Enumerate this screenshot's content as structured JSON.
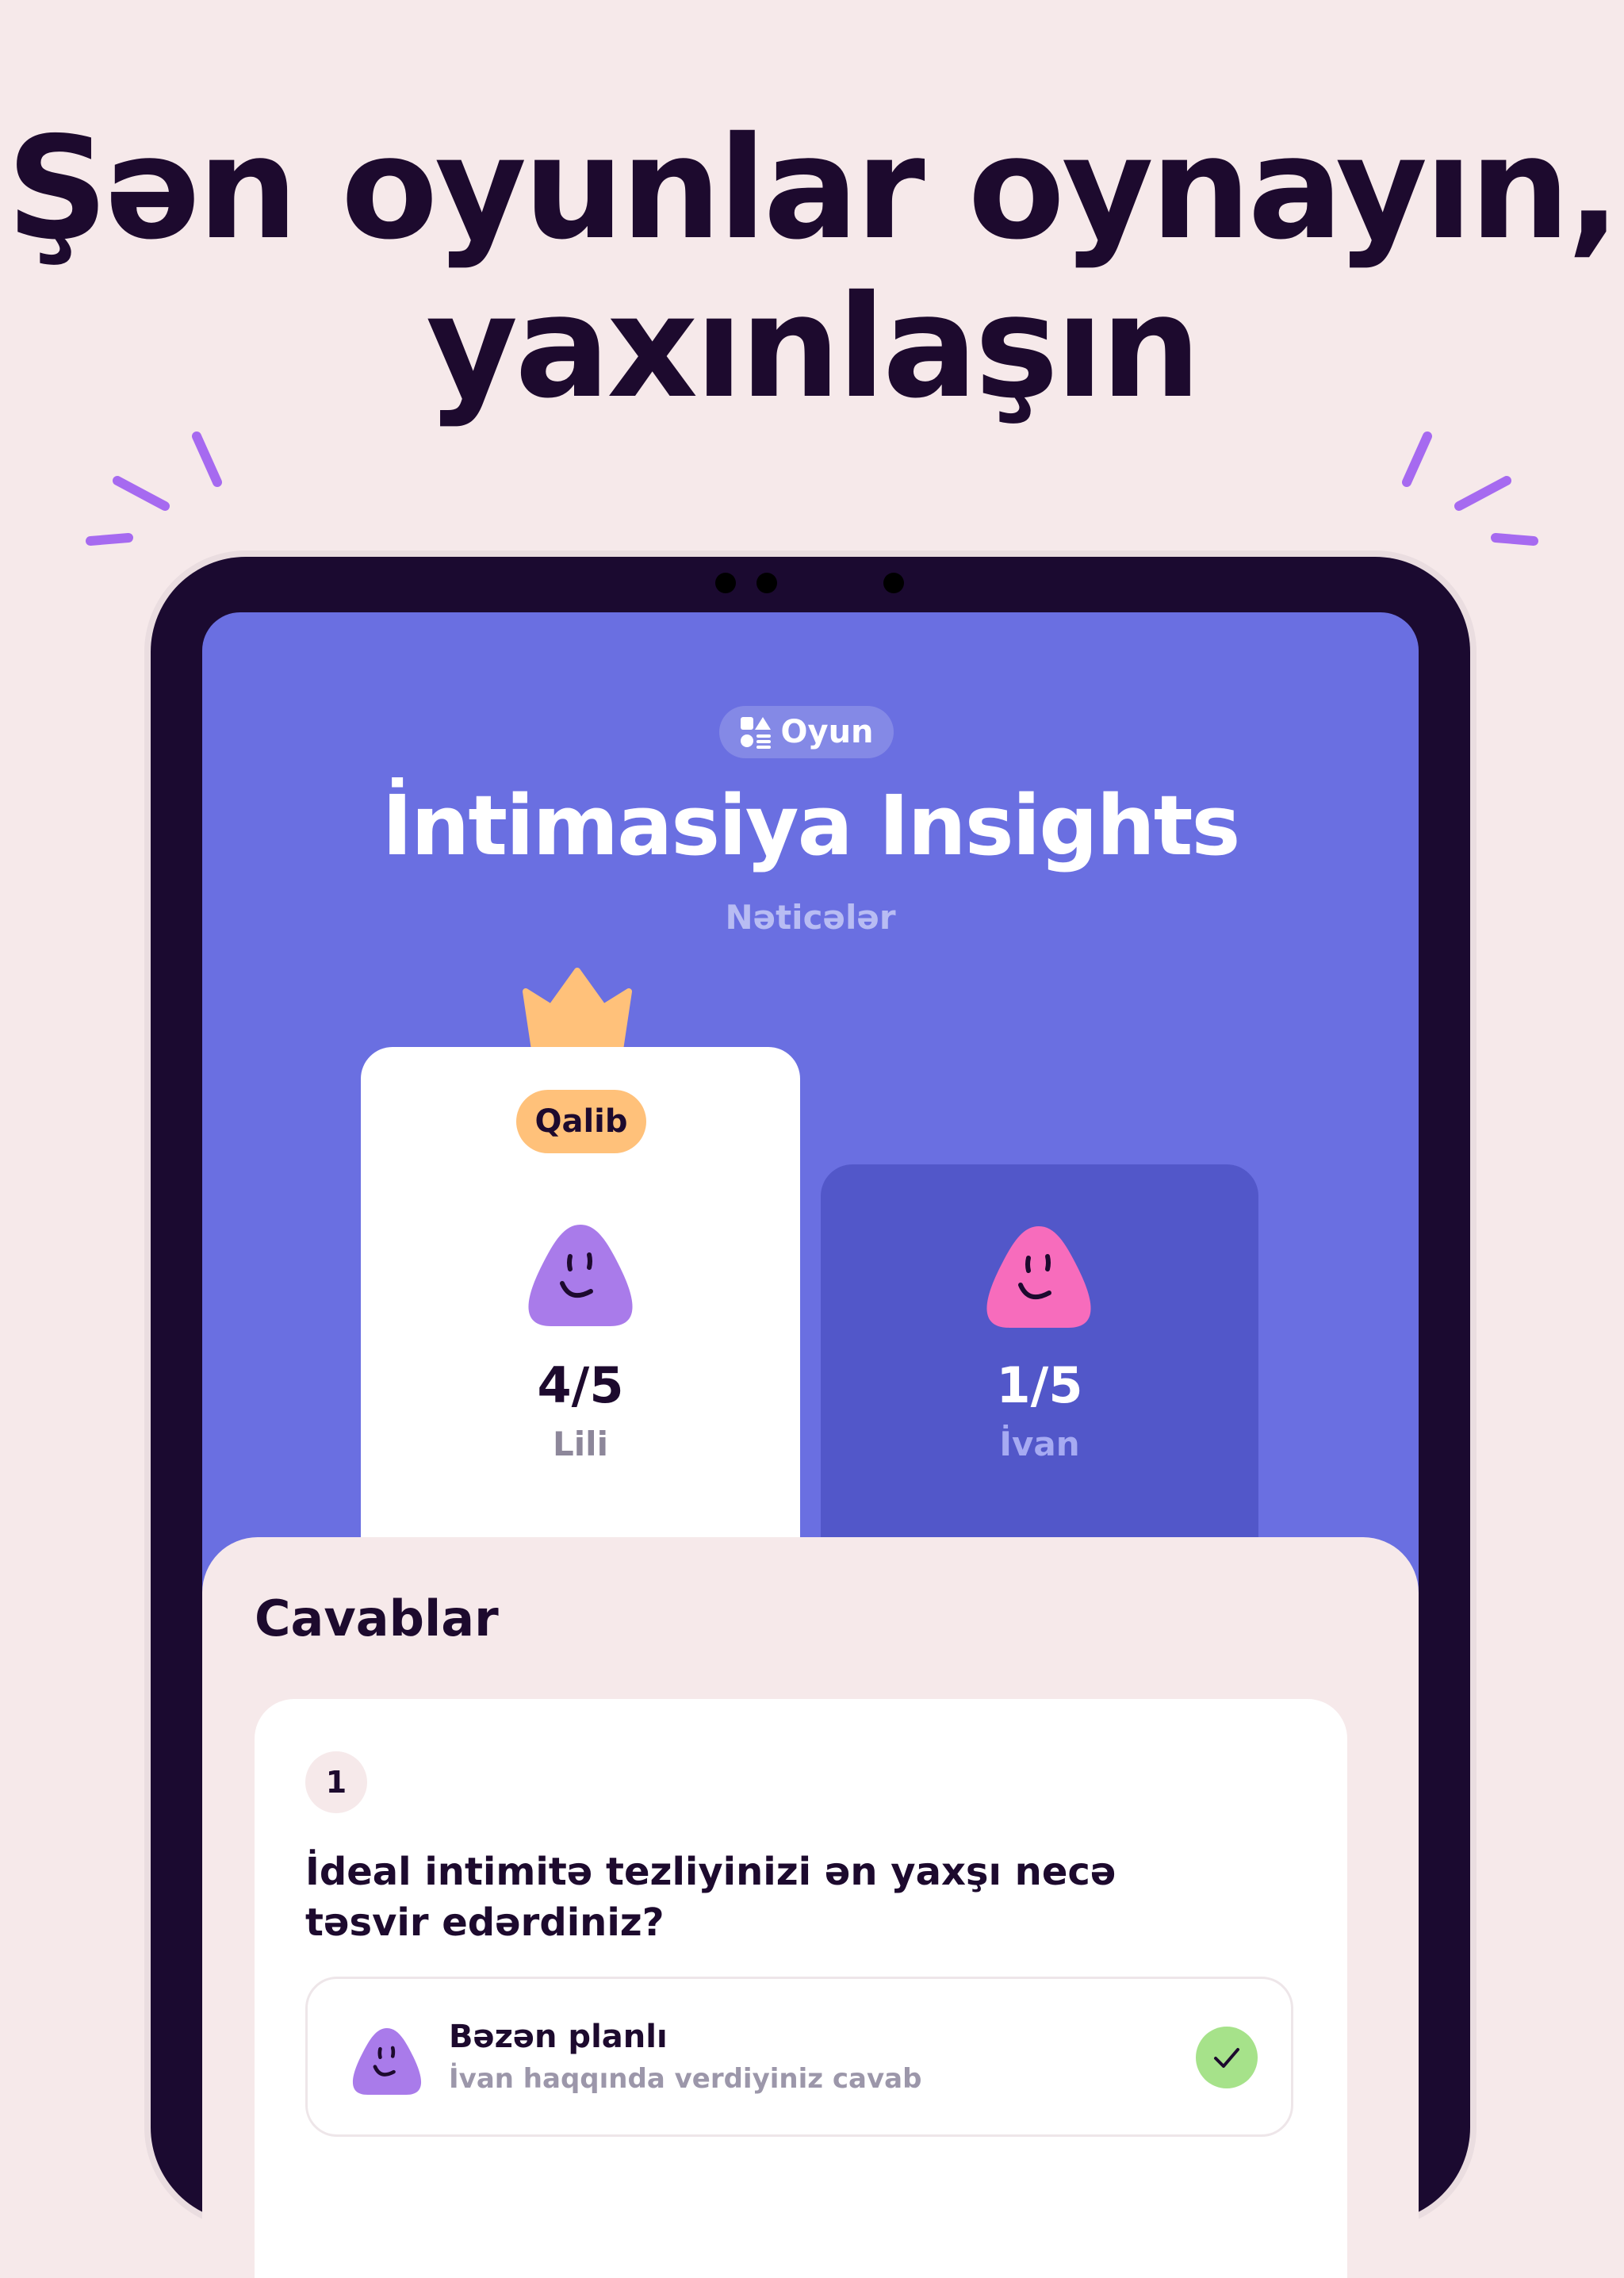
{
  "headline": {
    "line1": "Şən oyunlar oynayın,",
    "line2": "yaxınlaşın"
  },
  "colors": {
    "page_bg": "#f6e9ea",
    "ink": "#1d0a2e",
    "screen_bg": "#6a6fe1",
    "accent_purple": "#a97bea",
    "accent_pink": "#f76cbc",
    "winner_pill": "#ffc17a",
    "crown": "#ffc17a",
    "check": "#a6e28a"
  },
  "app": {
    "badge": {
      "icon": "shapes-icon",
      "label": "Oyun"
    },
    "title": "İntimasiya Insights",
    "subtitle": "Nəticələr",
    "players": [
      {
        "name": "Lili",
        "score": "4/5",
        "winner_label": "Qalib",
        "avatar_color": "#a97bea",
        "is_winner": true
      },
      {
        "name": "İvan",
        "score": "1/5",
        "avatar_color": "#f76cbc",
        "is_winner": false
      }
    ],
    "answers": {
      "title": "Cavablar",
      "items": [
        {
          "number": "1",
          "question": "İdeal intimitə tezliyinizi ən yaxşı necə təsvir edərdiniz?",
          "answer": "Bəzən planlı",
          "answer_note": "İvan haqqında verdiyiniz cavab",
          "correct": true
        }
      ]
    }
  }
}
